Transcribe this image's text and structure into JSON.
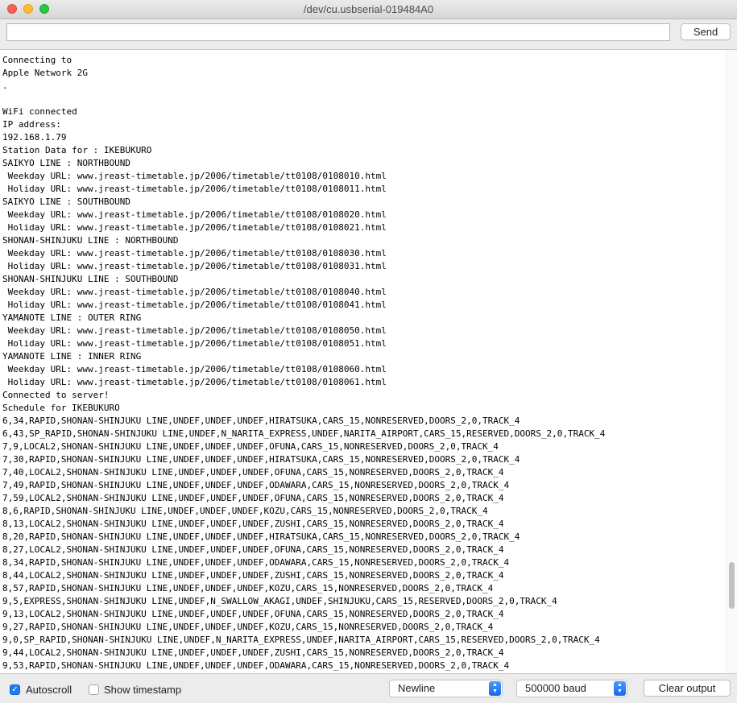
{
  "window": {
    "title": "/dev/cu.usbserial-019484A0"
  },
  "toolbar": {
    "input_value": "",
    "send_label": "Send"
  },
  "serial_lines": [
    "Connecting to",
    "Apple Network 2G",
    ".",
    "",
    "WiFi connected",
    "IP address:",
    "192.168.1.79",
    "Station Data for : IKEBUKURO",
    "SAIKYO LINE : NORTHBOUND",
    " Weekday URL: www.jreast-timetable.jp/2006/timetable/tt0108/0108010.html",
    " Holiday URL: www.jreast-timetable.jp/2006/timetable/tt0108/0108011.html",
    "SAIKYO LINE : SOUTHBOUND",
    " Weekday URL: www.jreast-timetable.jp/2006/timetable/tt0108/0108020.html",
    " Holiday URL: www.jreast-timetable.jp/2006/timetable/tt0108/0108021.html",
    "SHONAN-SHINJUKU LINE : NORTHBOUND",
    " Weekday URL: www.jreast-timetable.jp/2006/timetable/tt0108/0108030.html",
    " Holiday URL: www.jreast-timetable.jp/2006/timetable/tt0108/0108031.html",
    "SHONAN-SHINJUKU LINE : SOUTHBOUND",
    " Weekday URL: www.jreast-timetable.jp/2006/timetable/tt0108/0108040.html",
    " Holiday URL: www.jreast-timetable.jp/2006/timetable/tt0108/0108041.html",
    "YAMANOTE LINE : OUTER RING",
    " Weekday URL: www.jreast-timetable.jp/2006/timetable/tt0108/0108050.html",
    " Holiday URL: www.jreast-timetable.jp/2006/timetable/tt0108/0108051.html",
    "YAMANOTE LINE : INNER RING",
    " Weekday URL: www.jreast-timetable.jp/2006/timetable/tt0108/0108060.html",
    " Holiday URL: www.jreast-timetable.jp/2006/timetable/tt0108/0108061.html",
    "Connected to server!",
    "Schedule for IKEBUKURO",
    "6,34,RAPID,SHONAN-SHINJUKU LINE,UNDEF,UNDEF,UNDEF,HIRATSUKA,CARS_15,NONRESERVED,DOORS_2,0,TRACK_4",
    "6,43,SP_RAPID,SHONAN-SHINJUKU LINE,UNDEF,N_NARITA_EXPRESS,UNDEF,NARITA_AIRPORT,CARS_15,RESERVED,DOORS_2,0,TRACK_4",
    "7,9,LOCAL2,SHONAN-SHINJUKU LINE,UNDEF,UNDEF,UNDEF,OFUNA,CARS_15,NONRESERVED,DOORS_2,0,TRACK_4",
    "7,30,RAPID,SHONAN-SHINJUKU LINE,UNDEF,UNDEF,UNDEF,HIRATSUKA,CARS_15,NONRESERVED,DOORS_2,0,TRACK_4",
    "7,40,LOCAL2,SHONAN-SHINJUKU LINE,UNDEF,UNDEF,UNDEF,OFUNA,CARS_15,NONRESERVED,DOORS_2,0,TRACK_4",
    "7,49,RAPID,SHONAN-SHINJUKU LINE,UNDEF,UNDEF,UNDEF,ODAWARA,CARS_15,NONRESERVED,DOORS_2,0,TRACK_4",
    "7,59,LOCAL2,SHONAN-SHINJUKU LINE,UNDEF,UNDEF,UNDEF,OFUNA,CARS_15,NONRESERVED,DOORS_2,0,TRACK_4",
    "8,6,RAPID,SHONAN-SHINJUKU LINE,UNDEF,UNDEF,UNDEF,KOZU,CARS_15,NONRESERVED,DOORS_2,0,TRACK_4",
    "8,13,LOCAL2,SHONAN-SHINJUKU LINE,UNDEF,UNDEF,UNDEF,ZUSHI,CARS_15,NONRESERVED,DOORS_2,0,TRACK_4",
    "8,20,RAPID,SHONAN-SHINJUKU LINE,UNDEF,UNDEF,UNDEF,HIRATSUKA,CARS_15,NONRESERVED,DOORS_2,0,TRACK_4",
    "8,27,LOCAL2,SHONAN-SHINJUKU LINE,UNDEF,UNDEF,UNDEF,OFUNA,CARS_15,NONRESERVED,DOORS_2,0,TRACK_4",
    "8,34,RAPID,SHONAN-SHINJUKU LINE,UNDEF,UNDEF,UNDEF,ODAWARA,CARS_15,NONRESERVED,DOORS_2,0,TRACK_4",
    "8,44,LOCAL2,SHONAN-SHINJUKU LINE,UNDEF,UNDEF,UNDEF,ZUSHI,CARS_15,NONRESERVED,DOORS_2,0,TRACK_4",
    "8,57,RAPID,SHONAN-SHINJUKU LINE,UNDEF,UNDEF,UNDEF,KOZU,CARS_15,NONRESERVED,DOORS_2,0,TRACK_4",
    "9,5,EXPRESS,SHONAN-SHINJUKU LINE,UNDEF,N_SWALLOW_AKAGI,UNDEF,SHINJUKU,CARS_15,RESERVED,DOORS_2,0,TRACK_4",
    "9,13,LOCAL2,SHONAN-SHINJUKU LINE,UNDEF,UNDEF,UNDEF,OFUNA,CARS_15,NONRESERVED,DOORS_2,0,TRACK_4",
    "9,27,RAPID,SHONAN-SHINJUKU LINE,UNDEF,UNDEF,UNDEF,KOZU,CARS_15,NONRESERVED,DOORS_2,0,TRACK_4",
    "9,0,SP_RAPID,SHONAN-SHINJUKU LINE,UNDEF,N_NARITA_EXPRESS,UNDEF,NARITA_AIRPORT,CARS_15,RESERVED,DOORS_2,0,TRACK_4",
    "9,44,LOCAL2,SHONAN-SHINJUKU LINE,UNDEF,UNDEF,UNDEF,ZUSHI,CARS_15,NONRESERVED,DOORS_2,0,TRACK_4",
    "9,53,RAPID,SHONAN-SHINJUKU LINE,UNDEF,UNDEF,UNDEF,ODAWARA,CARS_15,NONRESERVED,DOORS_2,0,TRACK_4"
  ],
  "statusbar": {
    "autoscroll_label": "Autoscroll",
    "autoscroll_checked": true,
    "timestamp_label": "Show timestamp",
    "timestamp_checked": false,
    "line_ending": "Newline",
    "baud_rate": "500000 baud",
    "clear_label": "Clear output"
  },
  "icons": {
    "checkmark": "check-icon",
    "select_arrows": "up-down-chevron-icon"
  },
  "colors": {
    "accent": "#1c7cf4",
    "close": "#fd5f57",
    "minimize": "#febc2e",
    "maximize": "#28c840"
  }
}
